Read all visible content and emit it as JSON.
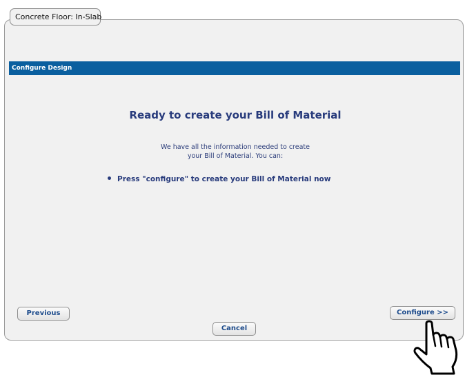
{
  "window": {
    "tab_title": "Concrete Floor: In-Slab"
  },
  "section": {
    "header": "Configure Design"
  },
  "content": {
    "heading": "Ready to create your Bill of Material",
    "info_line1": "We have all the information needed to create",
    "info_line2": "your Bill of Material. You can:",
    "bullet": "Press \"configure\" to create your Bill of Material now"
  },
  "buttons": {
    "previous": "Previous",
    "configure": "Configure >>",
    "cancel": "Cancel"
  },
  "cursor": {
    "icon": "hand-pointer-icon"
  },
  "colors": {
    "header_bg": "#0a5f9f",
    "heading_text": "#283b7c",
    "button_text": "#1e4c8c",
    "panel_bg": "#f1f1f1"
  }
}
